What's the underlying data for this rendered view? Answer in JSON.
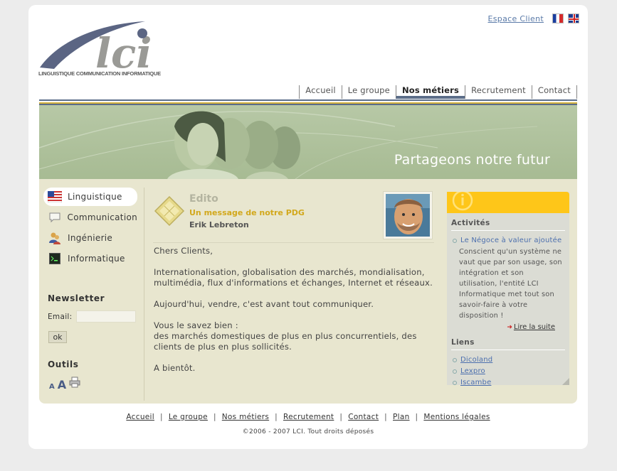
{
  "header": {
    "espace_client": "Espace Client",
    "logo_text": "lci",
    "logo_tagline": "LINGUISTIQUE COMMUNICATION INFORMATIQUE"
  },
  "nav": {
    "items": [
      {
        "label": "Accueil"
      },
      {
        "label": "Le groupe"
      },
      {
        "label": "Nos métiers",
        "active": true
      },
      {
        "label": "Recrutement"
      },
      {
        "label": "Contact"
      }
    ]
  },
  "banner": {
    "title": "Partageons notre futur"
  },
  "sidebar": {
    "items": [
      {
        "label": "Linguistique",
        "icon": "us-flag-icon",
        "active": true
      },
      {
        "label": "Communication",
        "icon": "speech-bubble-icon"
      },
      {
        "label": "Ingénierie",
        "icon": "people-icon"
      },
      {
        "label": "Informatique",
        "icon": "terminal-icon"
      }
    ],
    "newsletter_title": "Newsletter",
    "email_label": "Email:",
    "ok_label": "ok",
    "outils_title": "Outils",
    "font_small": "A",
    "font_large": "A"
  },
  "edito": {
    "title": "Edito",
    "subtitle": "Un message de notre PDG",
    "author": "Erik Lebreton",
    "paragraphs": [
      "Chers Clients,",
      "Internationalisation, globalisation des marchés, mondialisation,\nmultimédia, flux d'informations et échanges, Internet et réseaux.",
      "Aujourd'hui, vendre, c'est avant tout communiquer.",
      "Vous le savez bien :\ndes marchés domestiques de plus en plus concurrentiels, des\nclients de plus en plus sollicités.",
      "A bientôt."
    ]
  },
  "panel": {
    "activites_title": "Activités",
    "activite_link": "Le Négoce à valeur ajoutée",
    "activite_desc": "Conscient qu'un système ne vaut que par son usage, son intégration et son utilisation, l'entité LCI Informatique met tout son savoir-faire à votre disposition !",
    "read_more": "Lire la suite",
    "liens_title": "Liens",
    "liens": [
      "Dicoland",
      "Lexpro",
      "Iscambe"
    ]
  },
  "footer": {
    "links": [
      "Accueil",
      "Le groupe",
      "Nos métiers",
      "Recrutement",
      "Contact",
      "Plan",
      "Mentions légales"
    ],
    "copyright": "©2006 - 2007 LCI. Tout droits déposés"
  },
  "colors": {
    "accent_yellow": "#fec619",
    "nav_blue": "#5b6d89",
    "content_bg": "#e8e6cf",
    "link_blue": "#4c6fae"
  }
}
